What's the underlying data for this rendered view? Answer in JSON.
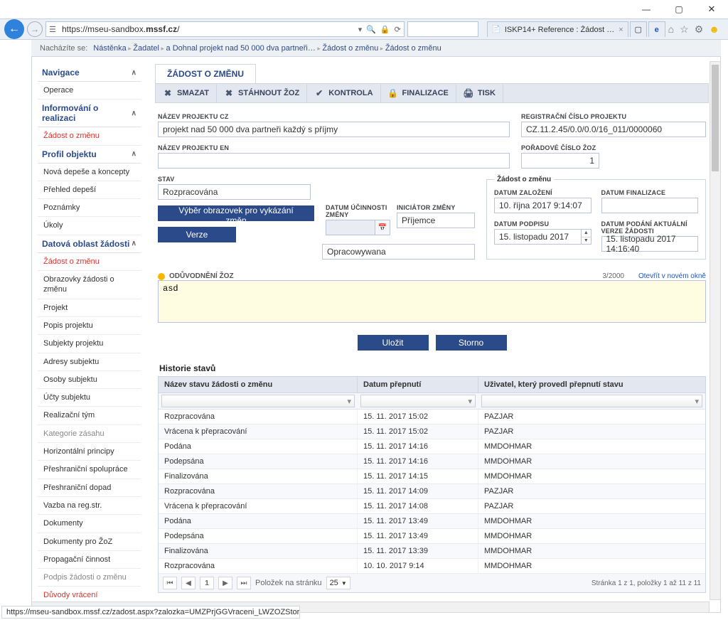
{
  "window": {
    "min": "—",
    "max": "▢",
    "close": "✕",
    "url_prefix": "https://mseu-sandbox.",
    "url_domain": "mssf.cz",
    "url_suffix": "/",
    "tab_label": "ISKP14+ Reference : Žádost …",
    "status_link": "https://mseu-sandbox.mssf.cz/zadost.aspx?zalozka=UMZPrjGGVraceni_LWZOZStorno"
  },
  "breadcrumb": {
    "label": "Nacházíte se:",
    "items": [
      "Nástěnka",
      "Žadatel",
      "a Dohnal projekt nad 50 000 dva partneři…",
      "Žádost o změnu",
      "Žádost o změnu"
    ]
  },
  "sidebar": {
    "groups": [
      {
        "title": "Navigace",
        "items": [
          {
            "t": "Operace"
          }
        ]
      },
      {
        "title": "Informování o realizaci",
        "items": [
          {
            "t": "Žádost o změnu",
            "red": true
          }
        ]
      },
      {
        "title": "Profil objektu",
        "items": [
          {
            "t": "Nová depeše a koncepty"
          },
          {
            "t": "Přehled depeší"
          },
          {
            "t": "Poznámky"
          },
          {
            "t": "Úkoly"
          }
        ]
      },
      {
        "title": "Datová oblast žádosti",
        "items": [
          {
            "t": "Žádost o změnu",
            "red": true
          },
          {
            "t": "Obrazovky žádosti o změnu"
          },
          {
            "t": "Projekt"
          },
          {
            "t": "Popis projektu"
          },
          {
            "t": "Subjekty projektu"
          },
          {
            "t": "Adresy subjektu"
          },
          {
            "t": "Osoby subjektu"
          },
          {
            "t": "Účty subjektu"
          },
          {
            "t": "Realizační tým"
          },
          {
            "t": "Kategorie zásahu",
            "gray": true
          },
          {
            "t": "Horizontální principy"
          },
          {
            "t": "Přeshraniční spolupráce"
          },
          {
            "t": "Přeshraniční dopad"
          },
          {
            "t": "Vazba na reg.str."
          },
          {
            "t": "Dokumenty"
          },
          {
            "t": "Dokumenty pro ŽoZ"
          },
          {
            "t": "Propagační činnost"
          },
          {
            "t": "Podpis žádosti o změnu",
            "gray": true
          },
          {
            "t": "Důvody vrácení",
            "red": true
          }
        ]
      }
    ]
  },
  "page": {
    "tab": "ŽÁDOST O ZMĚNU",
    "toolbar": [
      {
        "icon": "✖",
        "label": "SMAZAT"
      },
      {
        "icon": "✖",
        "label": "STÁHNOUT ŽOZ"
      },
      {
        "icon": "✔",
        "label": "KONTROLA"
      },
      {
        "icon": "🔒",
        "label": "FINALIZACE"
      },
      {
        "icon": "🖨",
        "label": "TISK"
      }
    ]
  },
  "form": {
    "proj_cz_lbl": "NÁZEV PROJEKTU CZ",
    "proj_cz": "projekt nad 50 000 dva partneři každý s příjmy",
    "reg_lbl": "REGISTRAČNÍ ČÍSLO PROJEKTU",
    "reg": "CZ.11.2.45/0.0/0.0/16_011/0000060",
    "proj_en_lbl": "NÁZEV PROJEKTU EN",
    "proj_en": "",
    "seq_lbl": "POŘADOVÉ ČÍSLO ŽOZ",
    "seq": "1",
    "stav_lbl": "STAV",
    "stav_cz": "Rozpracována",
    "stav_pl": "Opracowywana",
    "btn_screens": "Výběr obrazovek pro vykázání změn",
    "btn_version": "Verze",
    "eff_lbl": "DATUM ÚČINNOSTI ZMĚNY",
    "init_lbl": "INICIÁTOR ZMĚNY",
    "init": "Příjemce",
    "fs_legend": "Žádost o změnu",
    "founded_lbl": "DATUM ZALOŽENÍ",
    "founded": "10. října 2017 9:14:07",
    "final_lbl": "DATUM FINALIZACE",
    "final": "",
    "sign_lbl": "DATUM PODPISU",
    "sign": "15. listopadu 2017",
    "curver_lbl": "DATUM PODÁNÍ AKTUÁLNÍ VERZE ŽÁDOSTI",
    "curver": "15. listopadu 2017 14:16:40",
    "just_lbl": "ODŮVODNĚNÍ ŽOZ",
    "just_val": "asd",
    "just_count": "3/2000",
    "just_link": "Otevřít v novém okně",
    "btn_save": "Uložit",
    "btn_cancel": "Storno"
  },
  "history": {
    "title": "Historie stavů",
    "cols": [
      "Název stavu žádosti o změnu",
      "Datum přepnutí",
      "Uživatel, který provedl přepnutí stavu"
    ],
    "rows": [
      [
        "Rozpracována",
        "15. 11. 2017 15:02",
        "PAZJAR"
      ],
      [
        "Vrácena k přepracování",
        "15. 11. 2017 15:02",
        "PAZJAR"
      ],
      [
        "Podána",
        "15. 11. 2017 14:16",
        "MMDOHMAR"
      ],
      [
        "Podepsána",
        "15. 11. 2017 14:16",
        "MMDOHMAR"
      ],
      [
        "Finalizována",
        "15. 11. 2017 14:15",
        "MMDOHMAR"
      ],
      [
        "Rozpracována",
        "15. 11. 2017 14:09",
        "PAZJAR"
      ],
      [
        "Vrácena k přepracování",
        "15. 11. 2017 14:08",
        "PAZJAR"
      ],
      [
        "Podána",
        "15. 11. 2017 13:49",
        "MMDOHMAR"
      ],
      [
        "Podepsána",
        "15. 11. 2017 13:49",
        "MMDOHMAR"
      ],
      [
        "Finalizována",
        "15. 11. 2017 13:39",
        "MMDOHMAR"
      ],
      [
        "Rozpracována",
        "10. 10. 2017 9:14",
        "MMDOHMAR"
      ]
    ],
    "pager_label": "Položek na stránku",
    "page_size": "25",
    "summary": "Stránka 1 z 1, položky 1 až 11 z 11"
  }
}
